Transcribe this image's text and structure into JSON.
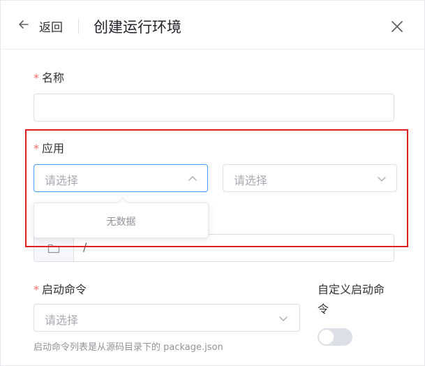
{
  "header": {
    "back_label": "返回",
    "title": "创建运行环境",
    "back_icon": "arrow-left-icon",
    "close_icon": "close-icon"
  },
  "form": {
    "name": {
      "label": "名称",
      "required": "*",
      "value": ""
    },
    "app": {
      "label": "应用",
      "required": "*",
      "select1_placeholder": "请选择",
      "select2_placeholder": "请选择",
      "dropdown_empty_text": "无数据"
    },
    "directory": {
      "icon": "folder-icon",
      "value": "/"
    },
    "start_command": {
      "label": "启动命令",
      "required": "*",
      "placeholder": "请选择",
      "hint": "启动命令列表是从源码目录下的 package.json"
    },
    "custom_start_command": {
      "label": "自定义启动命令",
      "enabled": false
    }
  },
  "colors": {
    "required": "#f56c6c",
    "focus": "#409eff",
    "highlight_box": "#e02020"
  }
}
